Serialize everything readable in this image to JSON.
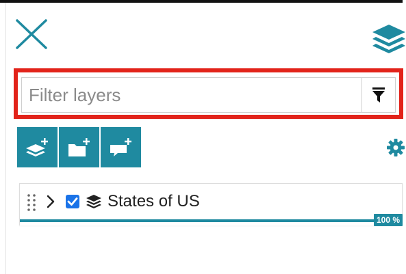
{
  "header": {
    "close_icon": "close-icon",
    "layers_icon": "layers-icon"
  },
  "filter": {
    "placeholder": "Filter layers",
    "value": "",
    "filter_icon": "funnel-icon"
  },
  "toolbar": {
    "buttons": [
      {
        "name": "add-layer-button",
        "icon": "layers-plus-icon"
      },
      {
        "name": "add-group-button",
        "icon": "folder-plus-icon"
      },
      {
        "name": "add-annotation-button",
        "icon": "comment-plus-icon"
      }
    ],
    "settings_icon": "gear-icon"
  },
  "layers": [
    {
      "name": "States of US",
      "checked": true,
      "opacity": 1.0,
      "opacity_label": "100 %"
    }
  ],
  "colors": {
    "accent": "#1f8aa0",
    "highlight_outline": "#e2231a",
    "checkbox": "#1a73e8"
  }
}
